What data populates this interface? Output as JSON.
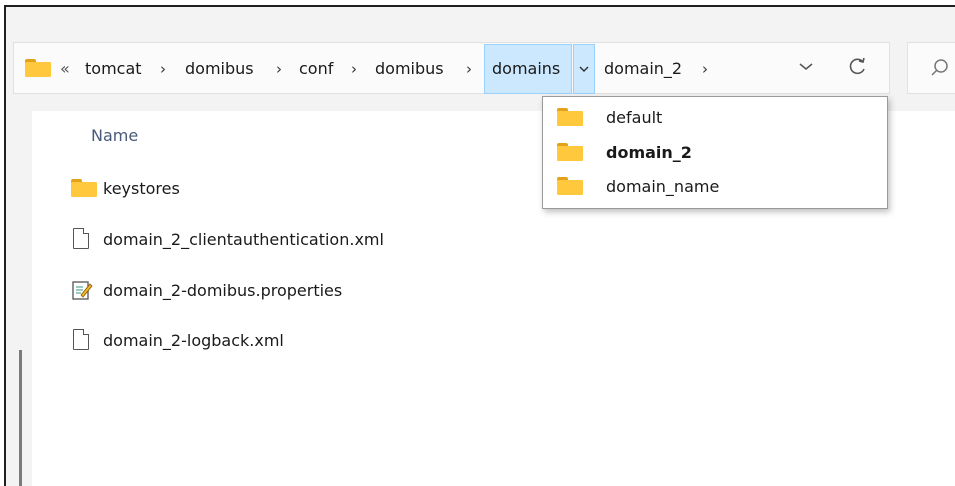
{
  "breadcrumb": {
    "overflow": "«",
    "items": [
      "tomcat",
      "domibus",
      "conf",
      "domibus",
      "domains",
      "domain_2"
    ],
    "separator": "›"
  },
  "toolbar": {
    "history_icon": "chevron-down-icon",
    "refresh_icon": "refresh-icon",
    "search_icon": "search-icon"
  },
  "dropdown": {
    "items": [
      {
        "label": "default",
        "bold": false
      },
      {
        "label": "domain_2",
        "bold": true
      },
      {
        "label": "domain_name",
        "bold": false
      }
    ]
  },
  "file_list": {
    "column_name": "Name",
    "items": [
      {
        "label": "keystores",
        "icon": "folder-icon"
      },
      {
        "label": "domain_2_clientauthentication.xml",
        "icon": "file-icon"
      },
      {
        "label": "domain_2-domibus.properties",
        "icon": "properties-file-icon"
      },
      {
        "label": "domain_2-logback.xml",
        "icon": "file-icon"
      }
    ]
  },
  "colors": {
    "folder": "#ffc83d",
    "selection": "#cce8ff",
    "selection_border": "#99d1ff"
  }
}
